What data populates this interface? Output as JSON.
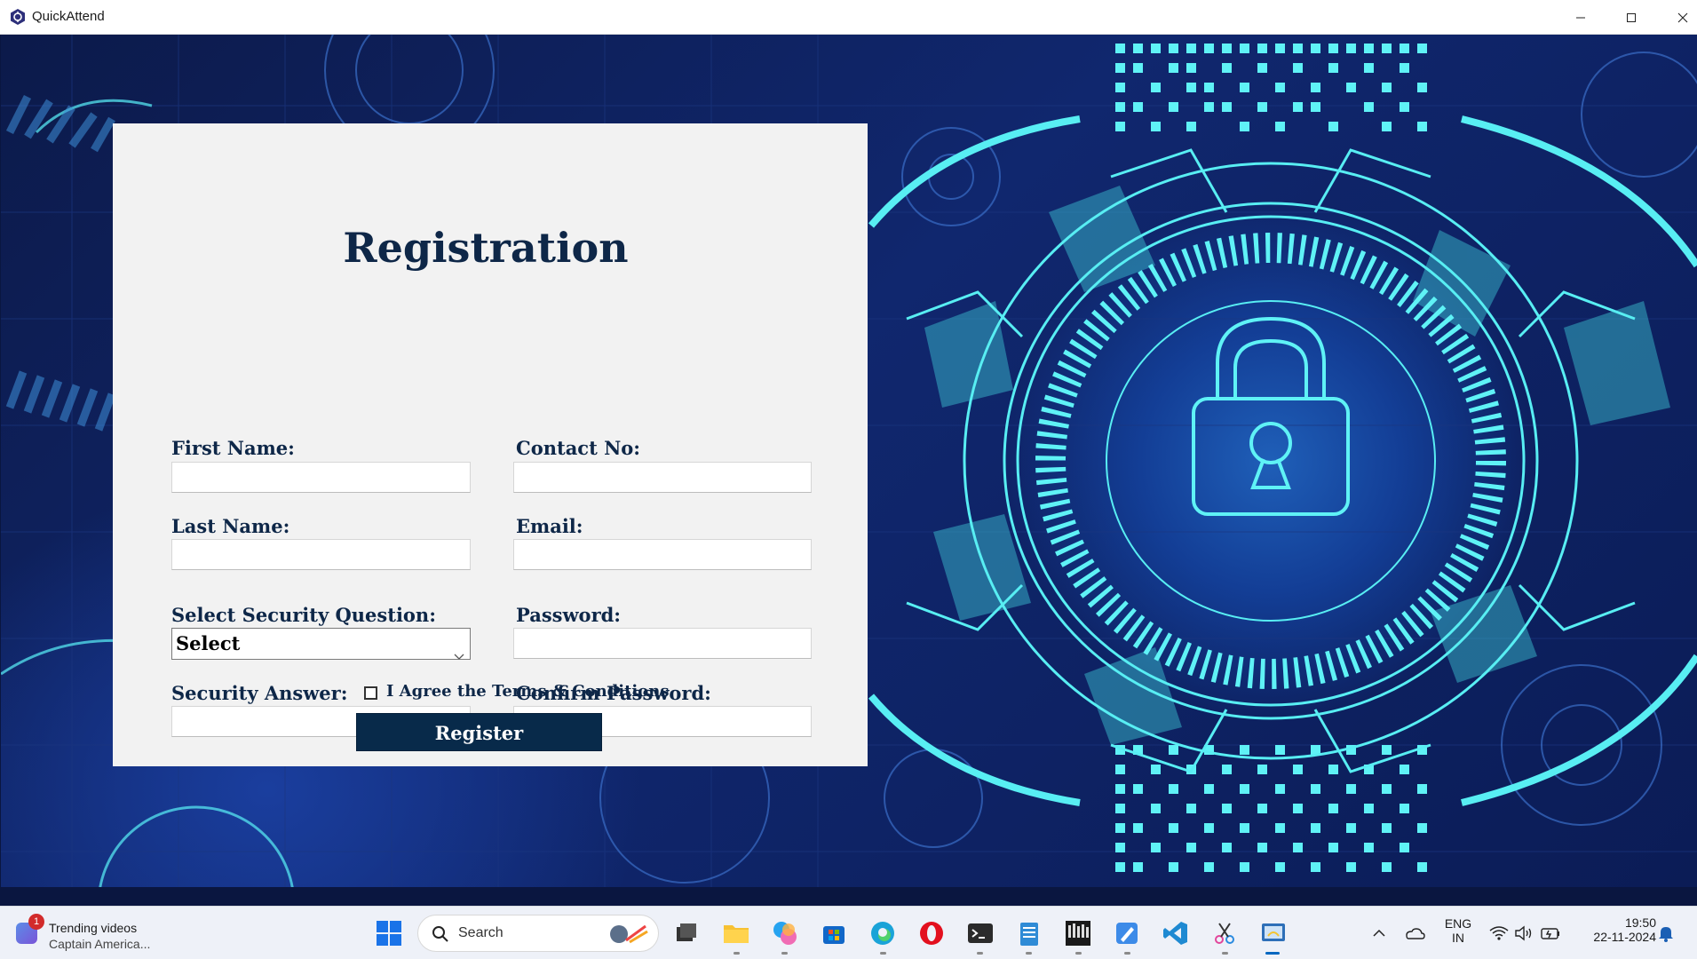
{
  "window": {
    "title": "QuickAttend",
    "controls": [
      "minimize",
      "maximize",
      "close"
    ]
  },
  "form": {
    "title": "Registration",
    "labels": {
      "first_name": "First Name:",
      "contact_no": "Contact No:",
      "last_name": "Last Name:",
      "email": "Email:",
      "security_question": "Select Security Question:",
      "password": "Password:",
      "security_answer": "Security Answer:",
      "confirm_password": "Confirm Password:"
    },
    "values": {
      "first_name": "",
      "contact_no": "",
      "last_name": "",
      "email": "",
      "security_question": "Select",
      "password": "",
      "security_answer": "",
      "confirm_password": ""
    },
    "terms_checked": false,
    "terms_label": "I Agree the Terms & Conditions",
    "register_label": "Register"
  },
  "colors": {
    "panel_bg": "#f2f2f2",
    "label_text": "#0e2748",
    "button_bg": "#082a4a",
    "accent_cyan": "#4de8f0"
  },
  "taskbar": {
    "widget": {
      "badge": "1",
      "line1": "Trending videos",
      "line2": "Captain America..."
    },
    "search_placeholder": "Search",
    "apps": [
      "windows-start",
      "search",
      "task-view",
      "file-explorer",
      "copilot",
      "microsoft-store",
      "edge",
      "opera",
      "terminal",
      "notepad",
      "hacker-app",
      "paint",
      "vs-code",
      "snipping-tool",
      "python-app"
    ],
    "tray": {
      "lang_line1": "ENG",
      "lang_line2": "IN",
      "time": "19:50",
      "date": "22-11-2024"
    }
  }
}
